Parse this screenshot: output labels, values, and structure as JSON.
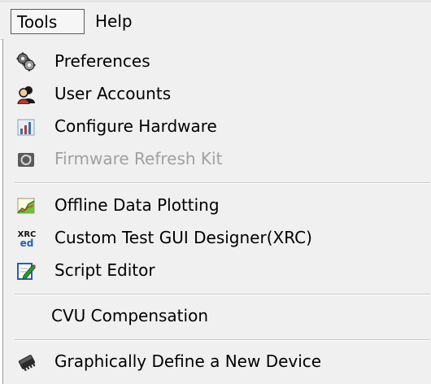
{
  "menubar": {
    "items": [
      {
        "label": "Tools"
      },
      {
        "label": "Help"
      }
    ]
  },
  "tools_menu": {
    "items": [
      {
        "label": "Preferences",
        "icon": "gears-icon",
        "enabled": true
      },
      {
        "label": "User Accounts",
        "icon": "users-icon",
        "enabled": true
      },
      {
        "label": "Configure Hardware",
        "icon": "hardware-chart-icon",
        "enabled": true
      },
      {
        "label": "Firmware Refresh Kit",
        "icon": "firmware-refresh-icon",
        "enabled": false
      },
      {
        "label": "Offline Data Plotting",
        "icon": "plot-icon",
        "enabled": true
      },
      {
        "label": "Custom Test GUI Designer(XRC)",
        "icon": "xrced-icon",
        "icon_text_top": "XRC",
        "icon_text_bottom": "ed",
        "enabled": true
      },
      {
        "label": "Script Editor",
        "icon": "script-edit-icon",
        "enabled": true
      },
      {
        "label": "CVU Compensation",
        "icon": "",
        "enabled": true
      },
      {
        "label": "Graphically Define a New Device",
        "icon": "device-chip-icon",
        "enabled": true
      }
    ]
  },
  "colors": {
    "menu_bg": "#f0f0f0",
    "disabled_text": "#a0a0a0",
    "separator": "#c8c8c8"
  }
}
